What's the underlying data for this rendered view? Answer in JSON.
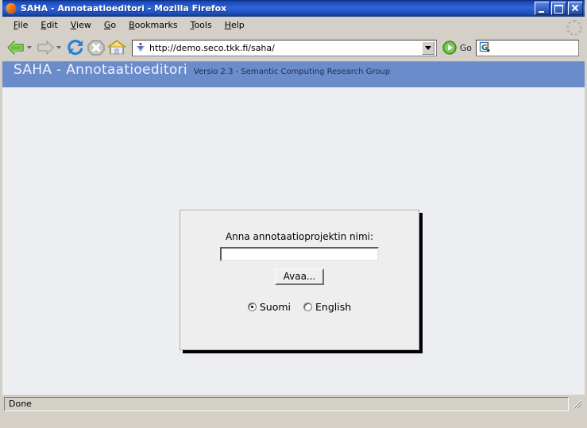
{
  "window": {
    "title": "SAHA - Annotaatioeditori - Mozilla Firefox",
    "app_icon": "firefox-icon",
    "controls": {
      "minimize": "minimize-button",
      "maximize": "maximize-button",
      "close": "close-button"
    }
  },
  "menubar": {
    "items": [
      {
        "label": "File",
        "accel": "F"
      },
      {
        "label": "Edit",
        "accel": "E"
      },
      {
        "label": "View",
        "accel": "V"
      },
      {
        "label": "Go",
        "accel": "G"
      },
      {
        "label": "Bookmarks",
        "accel": "B"
      },
      {
        "label": "Tools",
        "accel": "T"
      },
      {
        "label": "Help",
        "accel": "H"
      }
    ],
    "throbber": "throbber-icon"
  },
  "toolbar": {
    "back": "back-arrow-icon",
    "forward": "forward-arrow-icon",
    "reload": "reload-icon",
    "stop": "stop-icon",
    "home": "home-icon",
    "url_value": "http://demo.seco.tkk.fi/saha/",
    "url_placeholder": "",
    "favicon": "site-favicon",
    "dropdown": "chevron-down-icon",
    "go_label": "Go",
    "go_icon": "go-arrow-icon",
    "search_value": "",
    "search_placeholder": "",
    "search_engine_icon": "google-g-icon"
  },
  "page": {
    "banner": {
      "title": "SAHA - Annotaatioeditori",
      "subtitle": "Versio 2.3 - Semantic Computing Research Group",
      "background_color": "#6b8ccb",
      "title_color": "#eef2fb"
    },
    "dialog": {
      "prompt_label": "Anna annotaatioprojektin nimi:",
      "input_value": "",
      "input_placeholder": "",
      "open_button_label": "Avaa...",
      "languages": [
        {
          "label": "Suomi",
          "selected": true
        },
        {
          "label": "English",
          "selected": false
        }
      ]
    },
    "background_color": "#eceef2"
  },
  "statusbar": {
    "text": "Done",
    "grip": "resize-grip-icon"
  }
}
